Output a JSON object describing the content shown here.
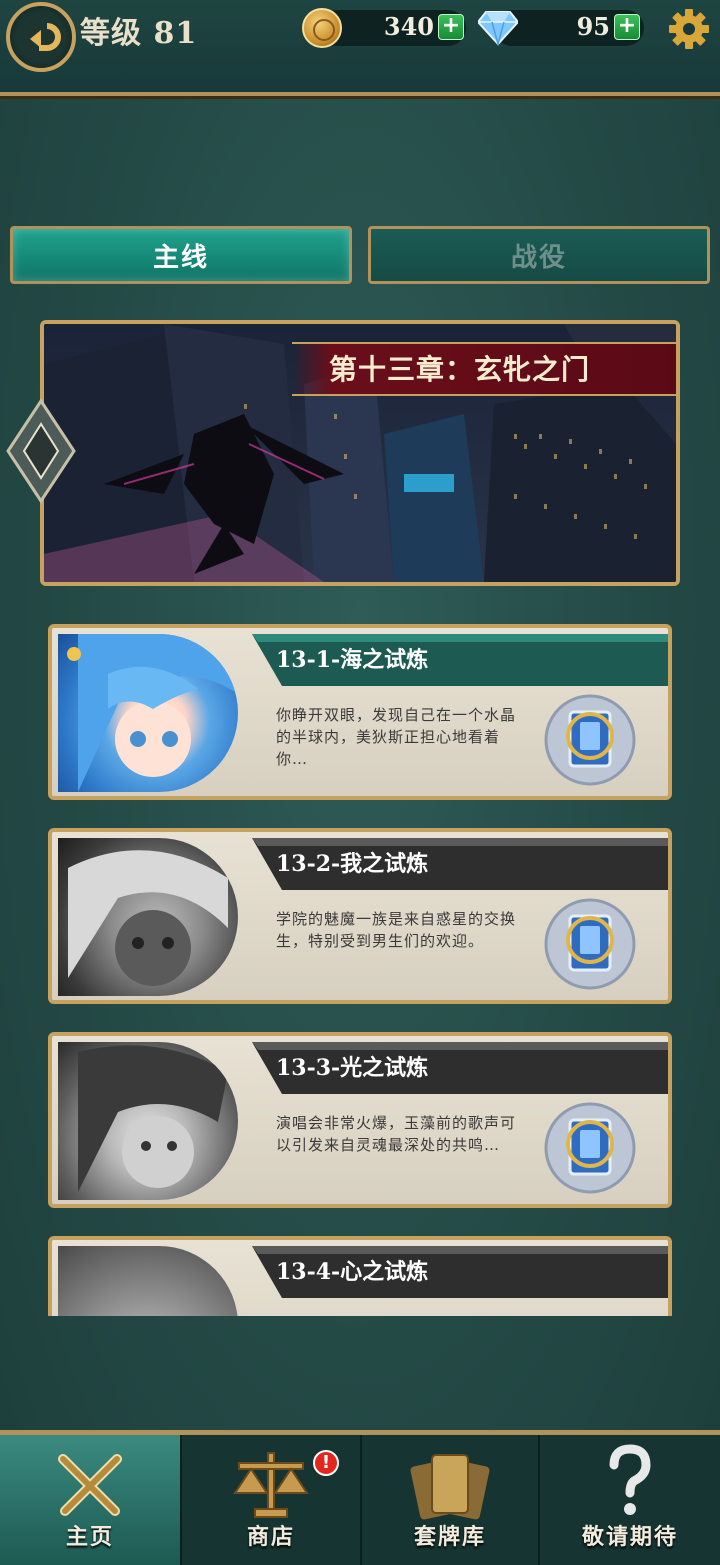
{
  "header": {
    "level_text": "等级 81",
    "gold_value": "340",
    "diamond_value": "95",
    "plus_symbol": "+"
  },
  "tabs": [
    {
      "label": "主线",
      "active": true
    },
    {
      "label": "战役",
      "active": false
    }
  ],
  "chapter": {
    "title": "第十三章：玄牝之门"
  },
  "stages": [
    {
      "title": "13-1-海之试炼",
      "desc": "你睁开双眼，发现自己在一个水晶的半球内，美狄斯正担心地看着你…",
      "unlocked": true
    },
    {
      "title": "13-2-我之试炼",
      "desc": "学院的魅魔一族是来自惑星的交换生，特别受到男生们的欢迎。",
      "unlocked": false
    },
    {
      "title": "13-3-光之试炼",
      "desc": "演唱会非常火爆，玉藻前的歌声可以引发来自灵魂最深处的共鸣…",
      "unlocked": false
    },
    {
      "title": "13-4-心之试炼",
      "desc": "",
      "unlocked": false
    }
  ],
  "nav": {
    "home": "主页",
    "shop": "商店",
    "deck": "套牌库",
    "soon": "敬请期待",
    "badge": "!"
  },
  "colors": {
    "gold_border": "#c7a15e",
    "active_tab": "#1fa38e",
    "background": "#254e4a",
    "banner_red": "#6a0e1a"
  },
  "icons": [
    "back-arrow-icon",
    "gold-coin-icon",
    "diamond-icon",
    "gear-icon",
    "crossed-swords-icon",
    "scales-icon",
    "cards-icon",
    "question-icon"
  ]
}
